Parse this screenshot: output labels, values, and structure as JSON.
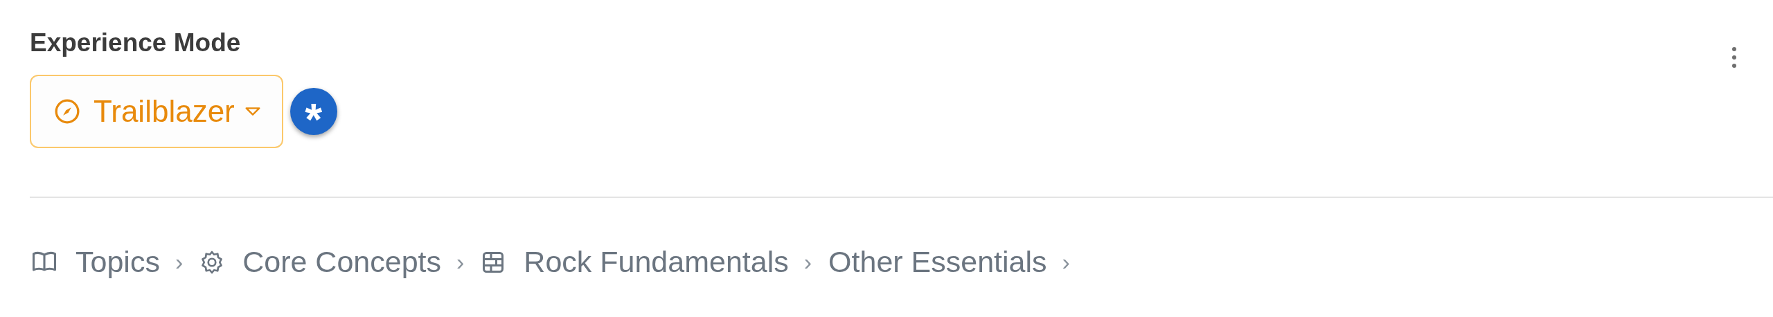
{
  "section": {
    "title": "Experience Mode"
  },
  "mode_button": {
    "label": "Trailblazer"
  },
  "help_badge": {
    "symbol": "*"
  },
  "breadcrumb": [
    {
      "label": "Topics",
      "kind": "book",
      "separator": "›"
    },
    {
      "label": "Core Concepts",
      "kind": "gear",
      "separator": "›"
    },
    {
      "label": "Rock Fundamentals",
      "kind": "bricks",
      "separator": "›"
    },
    {
      "label": "Other Essentials",
      "kind": "plain",
      "separator": "›"
    }
  ]
}
